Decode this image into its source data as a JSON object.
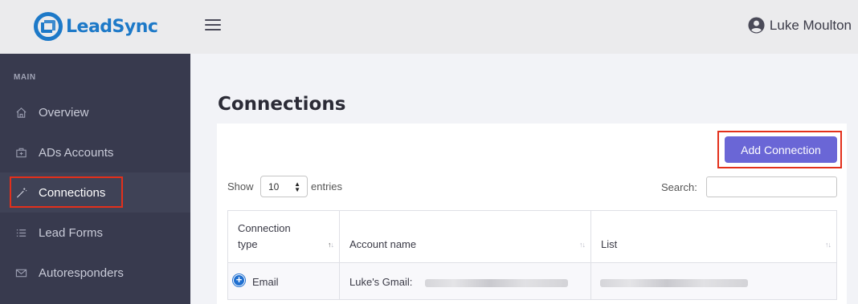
{
  "app": {
    "brand": "LeadSync",
    "brand_color": "#1d79c8"
  },
  "header": {
    "user_name": "Luke Moulton"
  },
  "sidebar": {
    "section_label": "MAIN",
    "items": [
      {
        "label": "Overview",
        "icon": "home-icon"
      },
      {
        "label": "ADs Accounts",
        "icon": "briefcase-icon"
      },
      {
        "label": "Connections",
        "icon": "magic-wand-icon",
        "active": true
      },
      {
        "label": "Lead Forms",
        "icon": "list-icon"
      },
      {
        "label": "Autoresponders",
        "icon": "envelope-icon"
      }
    ]
  },
  "main": {
    "title": "Connections",
    "add_button": "Add Connection",
    "accent_color": "#6a66d6",
    "highlight_color": "#e3301b"
  },
  "table_controls": {
    "show_label": "Show",
    "entries_value": "10",
    "entries_label": "entries",
    "search_label": "Search:",
    "search_value": ""
  },
  "table": {
    "columns": [
      "Connection type",
      "Account name",
      "List"
    ],
    "column_lines": [
      [
        "Connection",
        "type"
      ],
      [
        "Account name"
      ],
      [
        "List"
      ]
    ],
    "rows": [
      {
        "type": "Email",
        "account_name": "Luke's Gmail:",
        "list": ""
      }
    ]
  }
}
